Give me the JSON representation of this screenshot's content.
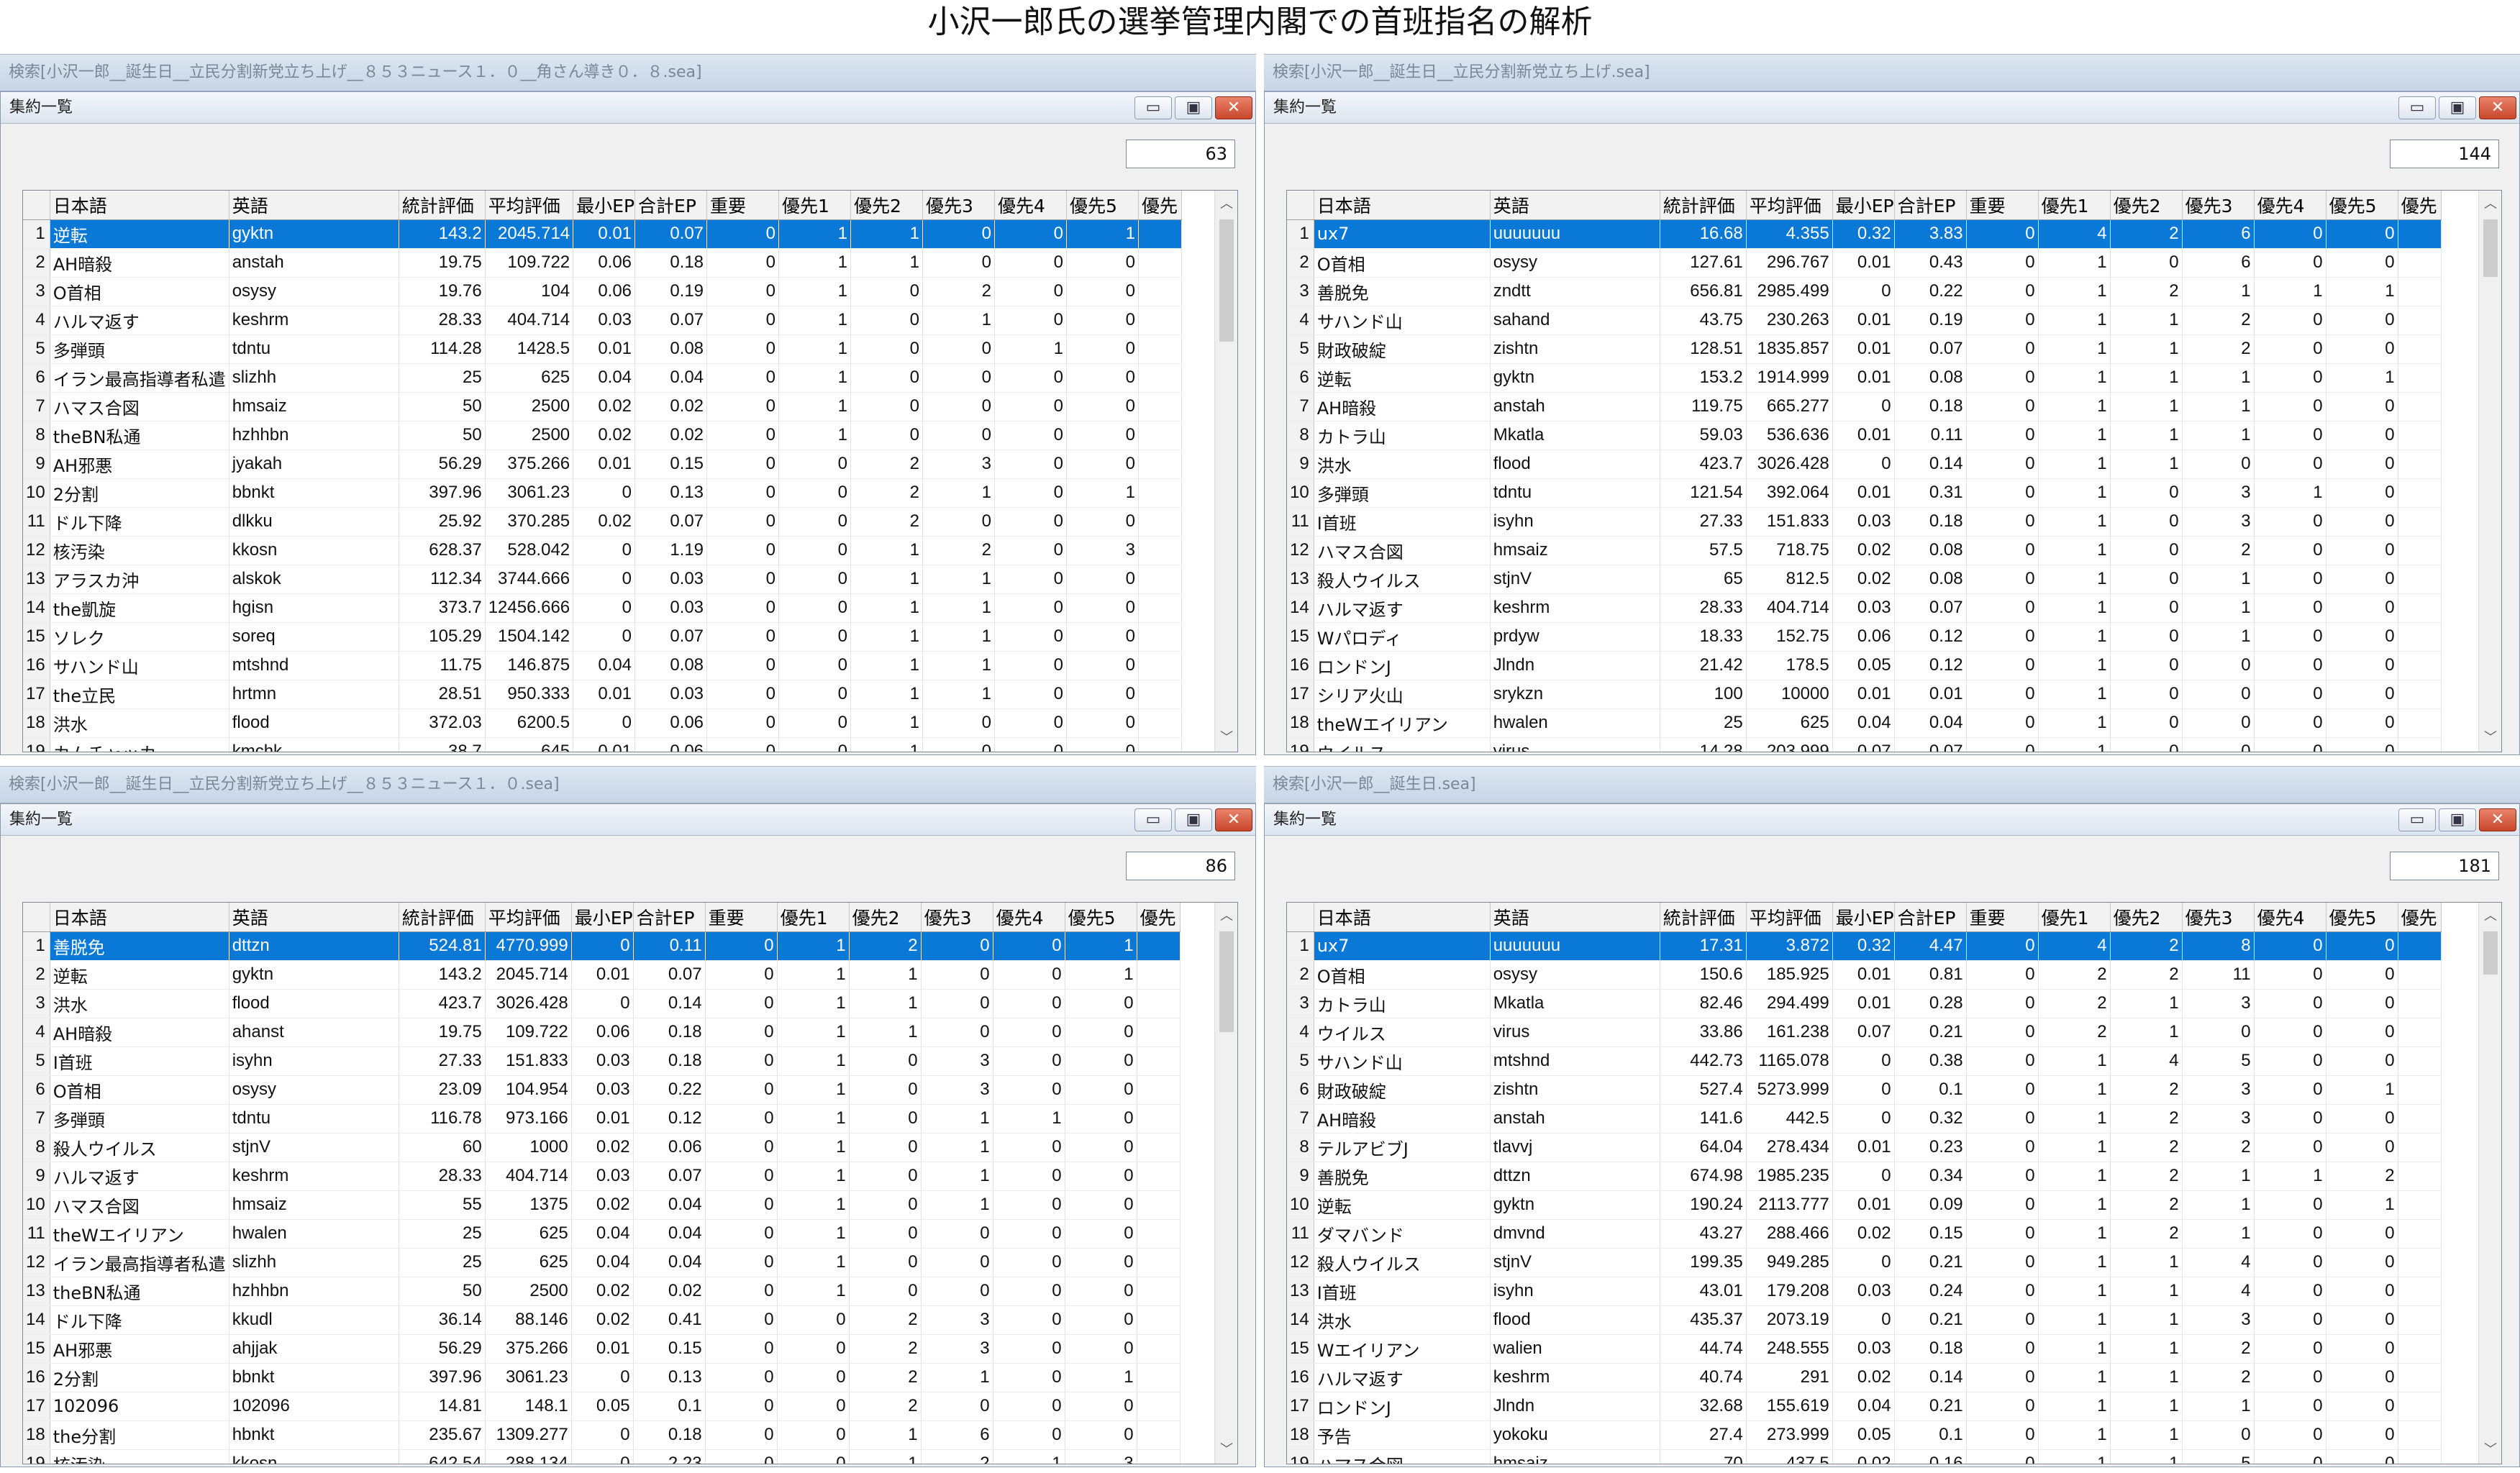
{
  "page_title": "小沢一郎氏の選挙管理内閣での首班指名の解析",
  "columns": [
    "日本語",
    "英語",
    "統計評価",
    "平均評価",
    "最小EP",
    "合計EP",
    "重要",
    "優先1",
    "優先2",
    "優先3",
    "優先4",
    "優先5",
    "優先"
  ],
  "window_buttons": {
    "minimize": "▭",
    "restore": "▣",
    "close": "✕"
  },
  "scroll_arrows": {
    "up": "︿",
    "down": "﹀"
  },
  "panels": [
    {
      "search_text": "検索[小沢一郎__誕生日__立民分割新党立ち上げ__８５３ニュース１．０__角さん導き０．８.sea]",
      "window_title": "集約一覧",
      "count": "63",
      "rows": [
        [
          "1",
          "逆転",
          "gyktn",
          "143.2",
          "2045.714",
          "0.01",
          "0.07",
          "0",
          "1",
          "1",
          "0",
          "0",
          "1"
        ],
        [
          "2",
          "AH暗殺",
          "anstah",
          "19.75",
          "109.722",
          "0.06",
          "0.18",
          "0",
          "1",
          "1",
          "0",
          "0",
          "0"
        ],
        [
          "3",
          "O首相",
          "osysy",
          "19.76",
          "104",
          "0.06",
          "0.19",
          "0",
          "1",
          "0",
          "2",
          "0",
          "0"
        ],
        [
          "4",
          "ハルマ返す",
          "keshrm",
          "28.33",
          "404.714",
          "0.03",
          "0.07",
          "0",
          "1",
          "0",
          "1",
          "0",
          "0"
        ],
        [
          "5",
          "多弾頭",
          "tdntu",
          "114.28",
          "1428.5",
          "0.01",
          "0.08",
          "0",
          "1",
          "0",
          "0",
          "1",
          "0"
        ],
        [
          "6",
          "イラン最高指導者私遣",
          "slizhh",
          "25",
          "625",
          "0.04",
          "0.04",
          "0",
          "1",
          "0",
          "0",
          "0",
          "0"
        ],
        [
          "7",
          "ハマス合図",
          "hmsaiz",
          "50",
          "2500",
          "0.02",
          "0.02",
          "0",
          "1",
          "0",
          "0",
          "0",
          "0"
        ],
        [
          "8",
          "theBN私通",
          "hzhhbn",
          "50",
          "2500",
          "0.02",
          "0.02",
          "0",
          "1",
          "0",
          "0",
          "0",
          "0"
        ],
        [
          "9",
          "AH邪悪",
          "jyakah",
          "56.29",
          "375.266",
          "0.01",
          "0.15",
          "0",
          "0",
          "2",
          "3",
          "0",
          "0"
        ],
        [
          "10",
          "2分割",
          "bbnkt",
          "397.96",
          "3061.23",
          "0",
          "0.13",
          "0",
          "0",
          "2",
          "1",
          "0",
          "1"
        ],
        [
          "11",
          "ドル下降",
          "dlkku",
          "25.92",
          "370.285",
          "0.02",
          "0.07",
          "0",
          "0",
          "2",
          "0",
          "0",
          "0"
        ],
        [
          "12",
          "核汚染",
          "kkosn",
          "628.37",
          "528.042",
          "0",
          "1.19",
          "0",
          "0",
          "1",
          "2",
          "0",
          "3"
        ],
        [
          "13",
          "アラスカ沖",
          "alskok",
          "112.34",
          "3744.666",
          "0",
          "0.03",
          "0",
          "0",
          "1",
          "1",
          "0",
          "0"
        ],
        [
          "14",
          "the凱旋",
          "hgisn",
          "373.7",
          "12456.666",
          "0",
          "0.03",
          "0",
          "0",
          "1",
          "1",
          "0",
          "0"
        ],
        [
          "15",
          "ソレク",
          "soreq",
          "105.29",
          "1504.142",
          "0",
          "0.07",
          "0",
          "0",
          "1",
          "1",
          "0",
          "0"
        ],
        [
          "16",
          "サハンド山",
          "mtshnd",
          "11.75",
          "146.875",
          "0.04",
          "0.08",
          "0",
          "0",
          "1",
          "1",
          "0",
          "0"
        ],
        [
          "17",
          "the立民",
          "hrtmn",
          "28.51",
          "950.333",
          "0.01",
          "0.03",
          "0",
          "0",
          "1",
          "1",
          "0",
          "0"
        ],
        [
          "18",
          "洪水",
          "flood",
          "372.03",
          "6200.5",
          "0",
          "0.06",
          "0",
          "0",
          "1",
          "0",
          "0",
          "0"
        ],
        [
          "19",
          "カムチャッカ",
          "kmchk",
          "38.7",
          "645",
          "0.01",
          "0.06",
          "0",
          "0",
          "1",
          "0",
          "0",
          "0"
        ]
      ]
    },
    {
      "search_text": "検索[小沢一郎__誕生日__立民分割新党立ち上げ.sea]",
      "window_title": "集約一覧",
      "count": "144",
      "rows": [
        [
          "1",
          "ux7",
          "uuuuuuu",
          "16.68",
          "4.355",
          "0.32",
          "3.83",
          "0",
          "4",
          "2",
          "6",
          "0",
          "0"
        ],
        [
          "2",
          "O首相",
          "osysy",
          "127.61",
          "296.767",
          "0.01",
          "0.43",
          "0",
          "1",
          "0",
          "6",
          "0",
          "0"
        ],
        [
          "3",
          "善脱免",
          "zndtt",
          "656.81",
          "2985.499",
          "0",
          "0.22",
          "0",
          "1",
          "2",
          "1",
          "1",
          "1"
        ],
        [
          "4",
          "サハンド山",
          "sahand",
          "43.75",
          "230.263",
          "0.01",
          "0.19",
          "0",
          "1",
          "1",
          "2",
          "0",
          "0"
        ],
        [
          "5",
          "財政破綻",
          "zishtn",
          "128.51",
          "1835.857",
          "0.01",
          "0.07",
          "0",
          "1",
          "1",
          "2",
          "0",
          "0"
        ],
        [
          "6",
          "逆転",
          "gyktn",
          "153.2",
          "1914.999",
          "0.01",
          "0.08",
          "0",
          "1",
          "1",
          "1",
          "0",
          "1"
        ],
        [
          "7",
          "AH暗殺",
          "anstah",
          "119.75",
          "665.277",
          "0",
          "0.18",
          "0",
          "1",
          "1",
          "1",
          "0",
          "0"
        ],
        [
          "8",
          "カトラ山",
          "Mkatla",
          "59.03",
          "536.636",
          "0.01",
          "0.11",
          "0",
          "1",
          "1",
          "1",
          "0",
          "0"
        ],
        [
          "9",
          "洪水",
          "flood",
          "423.7",
          "3026.428",
          "0",
          "0.14",
          "0",
          "1",
          "1",
          "0",
          "0",
          "0"
        ],
        [
          "10",
          "多弾頭",
          "tdntu",
          "121.54",
          "392.064",
          "0.01",
          "0.31",
          "0",
          "1",
          "0",
          "3",
          "1",
          "0"
        ],
        [
          "11",
          "I首班",
          "isyhn",
          "27.33",
          "151.833",
          "0.03",
          "0.18",
          "0",
          "1",
          "0",
          "3",
          "0",
          "0"
        ],
        [
          "12",
          "ハマス合図",
          "hmsaiz",
          "57.5",
          "718.75",
          "0.02",
          "0.08",
          "0",
          "1",
          "0",
          "2",
          "0",
          "0"
        ],
        [
          "13",
          "殺人ウイルス",
          "stjnV",
          "65",
          "812.5",
          "0.02",
          "0.08",
          "0",
          "1",
          "0",
          "1",
          "0",
          "0"
        ],
        [
          "14",
          "ハルマ返す",
          "keshrm",
          "28.33",
          "404.714",
          "0.03",
          "0.07",
          "0",
          "1",
          "0",
          "1",
          "0",
          "0"
        ],
        [
          "15",
          "Wパロディ",
          "prdyw",
          "18.33",
          "152.75",
          "0.06",
          "0.12",
          "0",
          "1",
          "0",
          "1",
          "0",
          "0"
        ],
        [
          "16",
          "ロンドンJ",
          "Jlndn",
          "21.42",
          "178.5",
          "0.05",
          "0.12",
          "0",
          "1",
          "0",
          "0",
          "0",
          "0"
        ],
        [
          "17",
          "シリア火山",
          "srykzn",
          "100",
          "10000",
          "0.01",
          "0.01",
          "0",
          "1",
          "0",
          "0",
          "0",
          "0"
        ],
        [
          "18",
          "theWエイリアン",
          "hwalen",
          "25",
          "625",
          "0.04",
          "0.04",
          "0",
          "1",
          "0",
          "0",
          "0",
          "0"
        ],
        [
          "19",
          "ウイルス",
          "virus",
          "14.28",
          "203.999",
          "0.07",
          "0.07",
          "0",
          "1",
          "0",
          "0",
          "0",
          "0"
        ]
      ]
    },
    {
      "search_text": "検索[小沢一郎__誕生日__立民分割新党立ち上げ__８５３ニュース１．０.sea]",
      "window_title": "集約一覧",
      "count": "86",
      "rows": [
        [
          "1",
          "善脱免",
          "dttzn",
          "524.81",
          "4770.999",
          "0",
          "0.11",
          "0",
          "1",
          "2",
          "0",
          "0",
          "1"
        ],
        [
          "2",
          "逆転",
          "gyktn",
          "143.2",
          "2045.714",
          "0.01",
          "0.07",
          "0",
          "1",
          "1",
          "0",
          "0",
          "1"
        ],
        [
          "3",
          "洪水",
          "flood",
          "423.7",
          "3026.428",
          "0",
          "0.14",
          "0",
          "1",
          "1",
          "0",
          "0",
          "0"
        ],
        [
          "4",
          "AH暗殺",
          "ahanst",
          "19.75",
          "109.722",
          "0.06",
          "0.18",
          "0",
          "1",
          "1",
          "0",
          "0",
          "0"
        ],
        [
          "5",
          "I首班",
          "isyhn",
          "27.33",
          "151.833",
          "0.03",
          "0.18",
          "0",
          "1",
          "0",
          "3",
          "0",
          "0"
        ],
        [
          "6",
          "O首相",
          "osysy",
          "23.09",
          "104.954",
          "0.03",
          "0.22",
          "0",
          "1",
          "0",
          "3",
          "0",
          "0"
        ],
        [
          "7",
          "多弾頭",
          "tdntu",
          "116.78",
          "973.166",
          "0.01",
          "0.12",
          "0",
          "1",
          "0",
          "1",
          "1",
          "0"
        ],
        [
          "8",
          "殺人ウイルス",
          "stjnV",
          "60",
          "1000",
          "0.02",
          "0.06",
          "0",
          "1",
          "0",
          "1",
          "0",
          "0"
        ],
        [
          "9",
          "ハルマ返す",
          "keshrm",
          "28.33",
          "404.714",
          "0.03",
          "0.07",
          "0",
          "1",
          "0",
          "1",
          "0",
          "0"
        ],
        [
          "10",
          "ハマス合図",
          "hmsaiz",
          "55",
          "1375",
          "0.02",
          "0.04",
          "0",
          "1",
          "0",
          "1",
          "0",
          "0"
        ],
        [
          "11",
          "theWエイリアン",
          "hwalen",
          "25",
          "625",
          "0.04",
          "0.04",
          "0",
          "1",
          "0",
          "0",
          "0",
          "0"
        ],
        [
          "12",
          "イラン最高指導者私遣",
          "slizhh",
          "25",
          "625",
          "0.04",
          "0.04",
          "0",
          "1",
          "0",
          "0",
          "0",
          "0"
        ],
        [
          "13",
          "theBN私通",
          "hzhhbn",
          "50",
          "2500",
          "0.02",
          "0.02",
          "0",
          "1",
          "0",
          "0",
          "0",
          "0"
        ],
        [
          "14",
          "ドル下降",
          "kkudl",
          "36.14",
          "88.146",
          "0.02",
          "0.41",
          "0",
          "0",
          "2",
          "3",
          "0",
          "0"
        ],
        [
          "15",
          "AH邪悪",
          "ahjjak",
          "56.29",
          "375.266",
          "0.01",
          "0.15",
          "0",
          "0",
          "2",
          "3",
          "0",
          "0"
        ],
        [
          "16",
          "2分割",
          "bbnkt",
          "397.96",
          "3061.23",
          "0",
          "0.13",
          "0",
          "0",
          "2",
          "1",
          "0",
          "1"
        ],
        [
          "17",
          "102096",
          "102096",
          "14.81",
          "148.1",
          "0.05",
          "0.1",
          "0",
          "0",
          "2",
          "0",
          "0",
          "0"
        ],
        [
          "18",
          "the分割",
          "hbnkt",
          "235.67",
          "1309.277",
          "0",
          "0.18",
          "0",
          "0",
          "1",
          "6",
          "0",
          "0"
        ],
        [
          "19",
          "核汚染",
          "kkosn",
          "642.54",
          "288.134",
          "0",
          "2.23",
          "0",
          "0",
          "1",
          "2",
          "1",
          "3"
        ]
      ]
    },
    {
      "search_text": "検索[小沢一郎__誕生日.sea]",
      "window_title": "集約一覧",
      "count": "181",
      "rows": [
        [
          "1",
          "ux7",
          "uuuuuuu",
          "17.31",
          "3.872",
          "0.32",
          "4.47",
          "0",
          "4",
          "2",
          "8",
          "0",
          "0"
        ],
        [
          "2",
          "O首相",
          "osysy",
          "150.6",
          "185.925",
          "0.01",
          "0.81",
          "0",
          "2",
          "2",
          "11",
          "0",
          "0"
        ],
        [
          "3",
          "カトラ山",
          "Mkatla",
          "82.46",
          "294.499",
          "0.01",
          "0.28",
          "0",
          "2",
          "1",
          "3",
          "0",
          "0"
        ],
        [
          "4",
          "ウイルス",
          "virus",
          "33.86",
          "161.238",
          "0.07",
          "0.21",
          "0",
          "2",
          "1",
          "0",
          "0",
          "0"
        ],
        [
          "5",
          "サハンド山",
          "mtshnd",
          "442.73",
          "1165.078",
          "0",
          "0.38",
          "0",
          "1",
          "4",
          "5",
          "0",
          "0"
        ],
        [
          "6",
          "財政破綻",
          "zishtn",
          "527.4",
          "5273.999",
          "0",
          "0.1",
          "0",
          "1",
          "2",
          "3",
          "0",
          "1"
        ],
        [
          "7",
          "AH暗殺",
          "anstah",
          "141.6",
          "442.5",
          "0",
          "0.32",
          "0",
          "1",
          "2",
          "3",
          "0",
          "0"
        ],
        [
          "8",
          "テルアビブJ",
          "tlavvj",
          "64.04",
          "278.434",
          "0.01",
          "0.23",
          "0",
          "1",
          "2",
          "2",
          "0",
          "0"
        ],
        [
          "9",
          "善脱免",
          "dttzn",
          "674.98",
          "1985.235",
          "0",
          "0.34",
          "0",
          "1",
          "2",
          "1",
          "1",
          "2"
        ],
        [
          "10",
          "逆転",
          "gyktn",
          "190.24",
          "2113.777",
          "0.01",
          "0.09",
          "0",
          "1",
          "2",
          "1",
          "0",
          "1"
        ],
        [
          "11",
          "ダマバンド",
          "dmvnd",
          "43.27",
          "288.466",
          "0.02",
          "0.15",
          "0",
          "1",
          "2",
          "1",
          "0",
          "0"
        ],
        [
          "12",
          "殺人ウイルス",
          "stjnV",
          "199.35",
          "949.285",
          "0",
          "0.21",
          "0",
          "1",
          "1",
          "4",
          "0",
          "0"
        ],
        [
          "13",
          "I首班",
          "isyhn",
          "43.01",
          "179.208",
          "0.03",
          "0.24",
          "0",
          "1",
          "1",
          "4",
          "0",
          "0"
        ],
        [
          "14",
          "洪水",
          "flood",
          "435.37",
          "2073.19",
          "0",
          "0.21",
          "0",
          "1",
          "1",
          "3",
          "0",
          "0"
        ],
        [
          "15",
          "Wエイリアン",
          "walien",
          "44.74",
          "248.555",
          "0.03",
          "0.18",
          "0",
          "1",
          "1",
          "2",
          "0",
          "0"
        ],
        [
          "16",
          "ハルマ返す",
          "keshrm",
          "40.74",
          "291",
          "0.02",
          "0.14",
          "0",
          "1",
          "1",
          "2",
          "0",
          "0"
        ],
        [
          "17",
          "ロンドンJ",
          "Jlndn",
          "32.68",
          "155.619",
          "0.04",
          "0.21",
          "0",
          "1",
          "1",
          "1",
          "0",
          "0"
        ],
        [
          "18",
          "予告",
          "yokoku",
          "27.4",
          "273.999",
          "0.05",
          "0.1",
          "0",
          "1",
          "1",
          "0",
          "0",
          "0"
        ],
        [
          "19",
          "ハマス合図",
          "hmsaiz",
          "70",
          "437.5",
          "0.02",
          "0.16",
          "0",
          "1",
          "1",
          "5",
          "0",
          "0"
        ]
      ]
    }
  ]
}
